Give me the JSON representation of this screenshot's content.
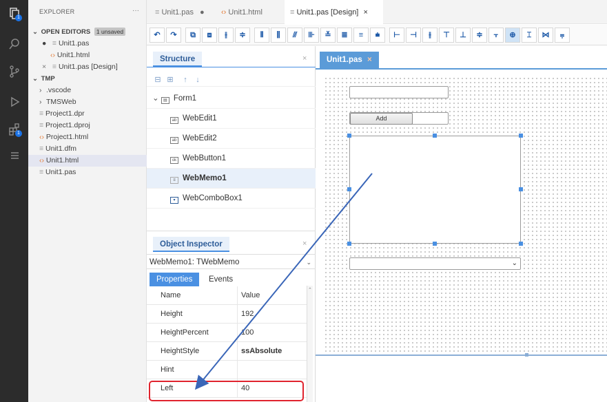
{
  "explorer": {
    "title": "EXPLORER",
    "more": "···",
    "open_editors_label": "OPEN EDITORS",
    "unsaved_badge": "1 unsaved",
    "open_editors": [
      {
        "label": "Unit1.pas",
        "prefix": "●",
        "icon": "pascal-file-icon"
      },
      {
        "label": "Unit1.html",
        "prefix": "",
        "icon": "html-file-icon"
      },
      {
        "label": "Unit1.pas [Design]",
        "prefix": "×",
        "icon": "pascal-file-icon"
      }
    ],
    "folder_label": "TMP",
    "files": [
      {
        "label": ".vscode",
        "folder": true
      },
      {
        "label": "TMSWeb",
        "folder": true
      },
      {
        "label": "Project1.dpr"
      },
      {
        "label": "Project1.dproj"
      },
      {
        "label": "Project1.html"
      },
      {
        "label": "Unit1.dfm"
      },
      {
        "label": "Unit1.html"
      },
      {
        "label": "Unit1.pas"
      }
    ]
  },
  "activity_badges": {
    "explorer": "1",
    "extensions": "1"
  },
  "tabs": [
    {
      "label": "Unit1.pas",
      "suffix": "●"
    },
    {
      "label": "Unit1.html",
      "suffix": ""
    },
    {
      "label": "Unit1.pas [Design]",
      "suffix": "×"
    }
  ],
  "structure": {
    "title": "Structure",
    "root": "Form1",
    "items": [
      "WebEdit1",
      "WebEdit2",
      "WebButton1",
      "WebMemo1",
      "WebComboBox1"
    ],
    "selected_index": 3
  },
  "inspector": {
    "title": "Object Inspector",
    "selected_object": "WebMemo1: TWebMemo",
    "tabs": [
      "Properties",
      "Events"
    ],
    "header": {
      "name": "Name",
      "value": "Value"
    },
    "rows": [
      {
        "name": "Height",
        "value": "192"
      },
      {
        "name": "HeightPercent",
        "value": "100"
      },
      {
        "name": "HeightStyle",
        "value": "ssAbsolute"
      },
      {
        "name": "Hint",
        "value": ""
      },
      {
        "name": "Left",
        "value": "40"
      }
    ]
  },
  "designer": {
    "tab_label": "Unit1.pas",
    "button_caption": "Add"
  },
  "colors": {
    "accent": "#4a90e2",
    "highlight": "#e0232d",
    "arrow": "#3a66b8"
  }
}
